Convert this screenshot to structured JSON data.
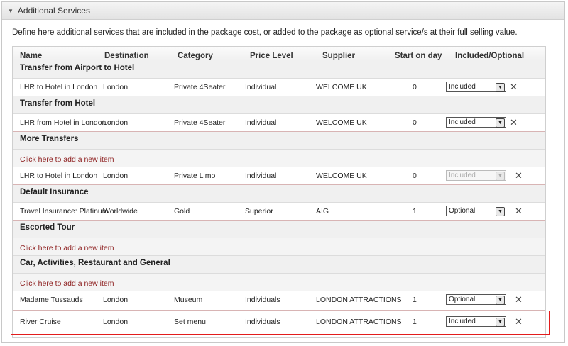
{
  "panel": {
    "title": "Additional Services"
  },
  "description": "Define here additional services that are included in the package cost, or added to the package as optional service/s at their full selling value.",
  "columns": [
    "Name",
    "Destination",
    "Category",
    "Price Level",
    "Supplier",
    "Start on day",
    "Included/Optional"
  ],
  "add_new_label": "Click here to add a new item",
  "groups": {
    "g1": "Transfer from Airport to Hotel",
    "g2": "Transfer from Hotel",
    "g3": "More Transfers",
    "g4": "Default Insurance",
    "g5": "Escorted Tour",
    "g6": "Car, Activities, Restaurant and General"
  },
  "rows": {
    "r1": {
      "name": "LHR to Hotel in London",
      "destination": "London",
      "category": "Private 4Seater",
      "price_level": "Individual",
      "supplier": "WELCOME UK",
      "start_day": "0",
      "option": "Included"
    },
    "r2": {
      "name": "LHR from Hotel in London",
      "destination": "London",
      "category": "Private 4Seater",
      "price_level": "Individual",
      "supplier": "WELCOME UK",
      "start_day": "0",
      "option": "Included"
    },
    "r3": {
      "name": "LHR to Hotel in London",
      "destination": "London",
      "category": "Private Limo",
      "price_level": "Individual",
      "supplier": "WELCOME UK",
      "start_day": "0",
      "option": "Included"
    },
    "r4": {
      "name": "Travel Insurance: Platinum",
      "destination": "Worldwide",
      "category": "Gold",
      "price_level": "Superior",
      "supplier": "AIG",
      "start_day": "1",
      "option": "Optional"
    },
    "r5": {
      "name": "Madame Tussauds",
      "destination": "London",
      "category": "Museum",
      "price_level": "Individuals",
      "supplier": "LONDON ATTRACTIONS",
      "start_day": "1",
      "option": "Optional"
    },
    "r6": {
      "name": "River Cruise",
      "destination": "London",
      "category": "Set menu",
      "price_level": "Individuals",
      "supplier": "LONDON ATTRACTIONS",
      "start_day": "1",
      "option": "Included"
    }
  },
  "icons": {
    "dropdown": "dropdown-arrow-icon",
    "delete": "close-x-icon",
    "collapse": "collapse-triangle-icon"
  },
  "colors": {
    "highlight": "#e31c1c",
    "link": "#8b1a1a"
  }
}
